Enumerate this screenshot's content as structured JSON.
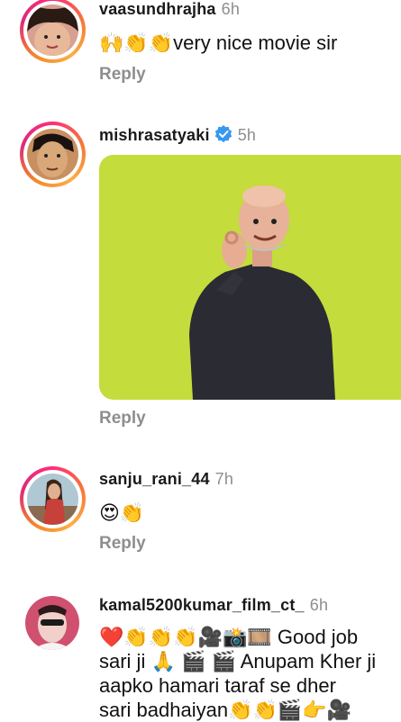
{
  "comments": [
    {
      "username": "vaasundhrajha",
      "time": "6h",
      "text": "🙌👏👏very nice movie sir",
      "reply": "Reply"
    },
    {
      "username": "mishrasatyaki",
      "time": "5h",
      "verified": true,
      "reply": "Reply"
    },
    {
      "username": "sanju_rani_44",
      "time": "7h",
      "text": "😍👏",
      "reply": "Reply"
    },
    {
      "username": "kamal5200kumar_film_ct_",
      "time": "6h",
      "text_lines": [
        "❤️👏👏👏🎥📸🎞️ Good job",
        "sari ji 🙏 🎬 🎬 Anupam Kher ji",
        "aapko hamari taraf se dher",
        "sari badhaiyan👏👏🎬👉🎥"
      ]
    }
  ],
  "colors": {
    "sticker_background": "#c4dc3c",
    "ring_gradient": [
      "#ff2d7a",
      "#fcaf45"
    ],
    "verified": "#3897f0",
    "secondary_text": "#8e8e8e"
  }
}
